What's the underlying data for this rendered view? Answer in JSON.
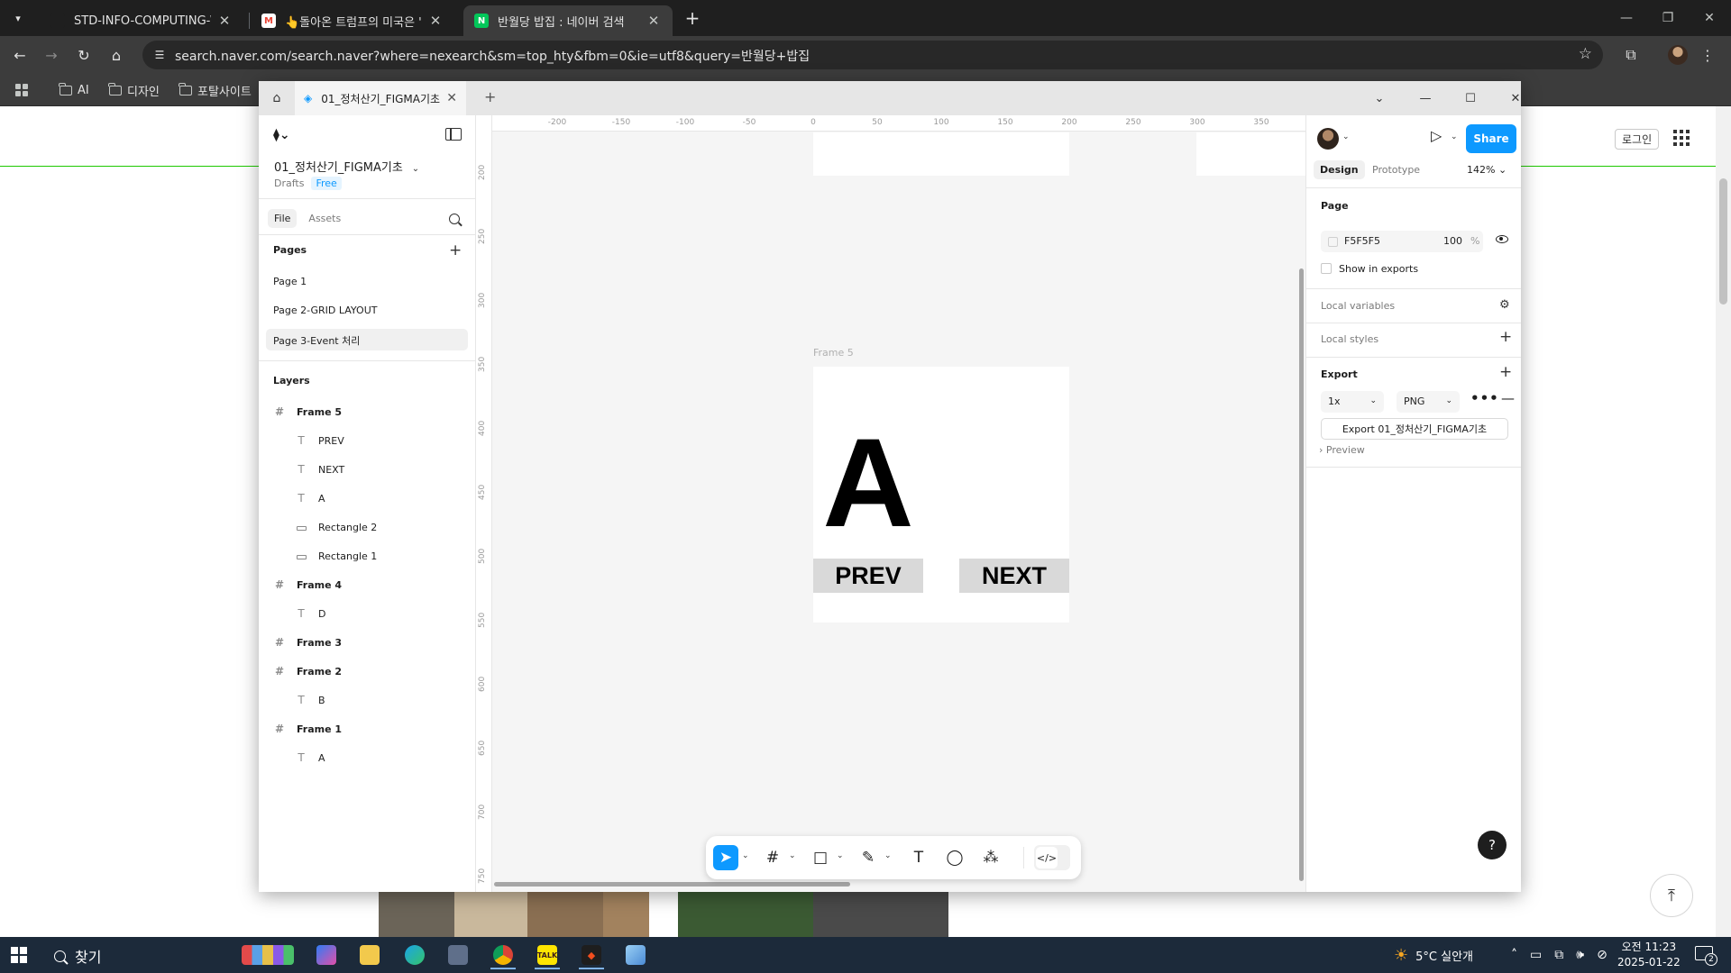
{
  "browser": {
    "tabs": [
      {
        "title": "STD-INFO-COMPUTING-WEB-",
        "favicon": "github-icon",
        "active": false
      },
      {
        "title": "👆돌아온 트럼프의 미국은 '자'",
        "favicon": "gmail-icon",
        "active": false
      },
      {
        "title": "반월당 밥집 : 네이버 검색",
        "favicon": "naver-icon",
        "active": true
      }
    ],
    "url": "search.naver.com/search.naver?where=nexearch&sm=top_hty&fbm=0&ie=utf8&query=반월당+밥집",
    "bookmarks": [
      "AI",
      "디자인",
      "포탈사이트"
    ]
  },
  "naver": {
    "login_label": "로그인",
    "accent_color": "#1ec800"
  },
  "figma": {
    "tab_title": "01_정처산기_FIGMA기초",
    "file_name": "01_정처산기_FIGMA기초",
    "drafts_label": "Drafts",
    "plan_badge": "Free",
    "left_tabs": [
      "File",
      "Assets"
    ],
    "pages_heading": "Pages",
    "pages": [
      "Page 1",
      "Page 2-GRID LAYOUT",
      "Page 3-Event 처리"
    ],
    "active_page_index": 2,
    "layers_heading": "Layers",
    "layers": [
      {
        "name": "Frame 5",
        "type": "frame"
      },
      {
        "name": "PREV",
        "type": "text"
      },
      {
        "name": "NEXT",
        "type": "text"
      },
      {
        "name": "A",
        "type": "text"
      },
      {
        "name": "Rectangle 2",
        "type": "rectangle"
      },
      {
        "name": "Rectangle 1",
        "type": "rectangle"
      },
      {
        "name": "Frame 4",
        "type": "frame"
      },
      {
        "name": "D",
        "type": "text"
      },
      {
        "name": "Frame 3",
        "type": "frame"
      },
      {
        "name": "Frame 2",
        "type": "frame"
      },
      {
        "name": "B",
        "type": "text"
      },
      {
        "name": "Frame 1",
        "type": "frame"
      },
      {
        "name": "A",
        "type": "text"
      }
    ],
    "ruler_top": [
      "-200",
      "-150",
      "-100",
      "-50",
      "0",
      "50",
      "100",
      "150",
      "200",
      "250",
      "300",
      "350"
    ],
    "ruler_left": [
      "200",
      "250",
      "300",
      "350",
      "400",
      "450",
      "500",
      "550",
      "600",
      "650",
      "700",
      "750"
    ],
    "canvas": {
      "frame_label": "Frame 5",
      "big_letter": "A",
      "prev_label": "PREV",
      "next_label": "NEXT"
    },
    "right": {
      "share_label": "Share",
      "tabs": [
        "Design",
        "Prototype"
      ],
      "zoom": "142%",
      "page_heading": "Page",
      "page_color_hex": "F5F5F5",
      "page_opacity": "100",
      "opacity_unit": "%",
      "show_in_exports": "Show in exports",
      "local_variables": "Local variables",
      "local_styles": "Local styles",
      "export_heading": "Export",
      "export_scale": "1x",
      "export_format": "PNG",
      "export_button": "Export 01_정처산기_FIGMA기초",
      "preview_label": "Preview",
      "help_label": "?"
    }
  },
  "taskbar": {
    "search_label": "찾기",
    "weather": "5°C  실안개",
    "time": "오전 11:23",
    "date": "2025-01-22",
    "notification_count": "2"
  }
}
